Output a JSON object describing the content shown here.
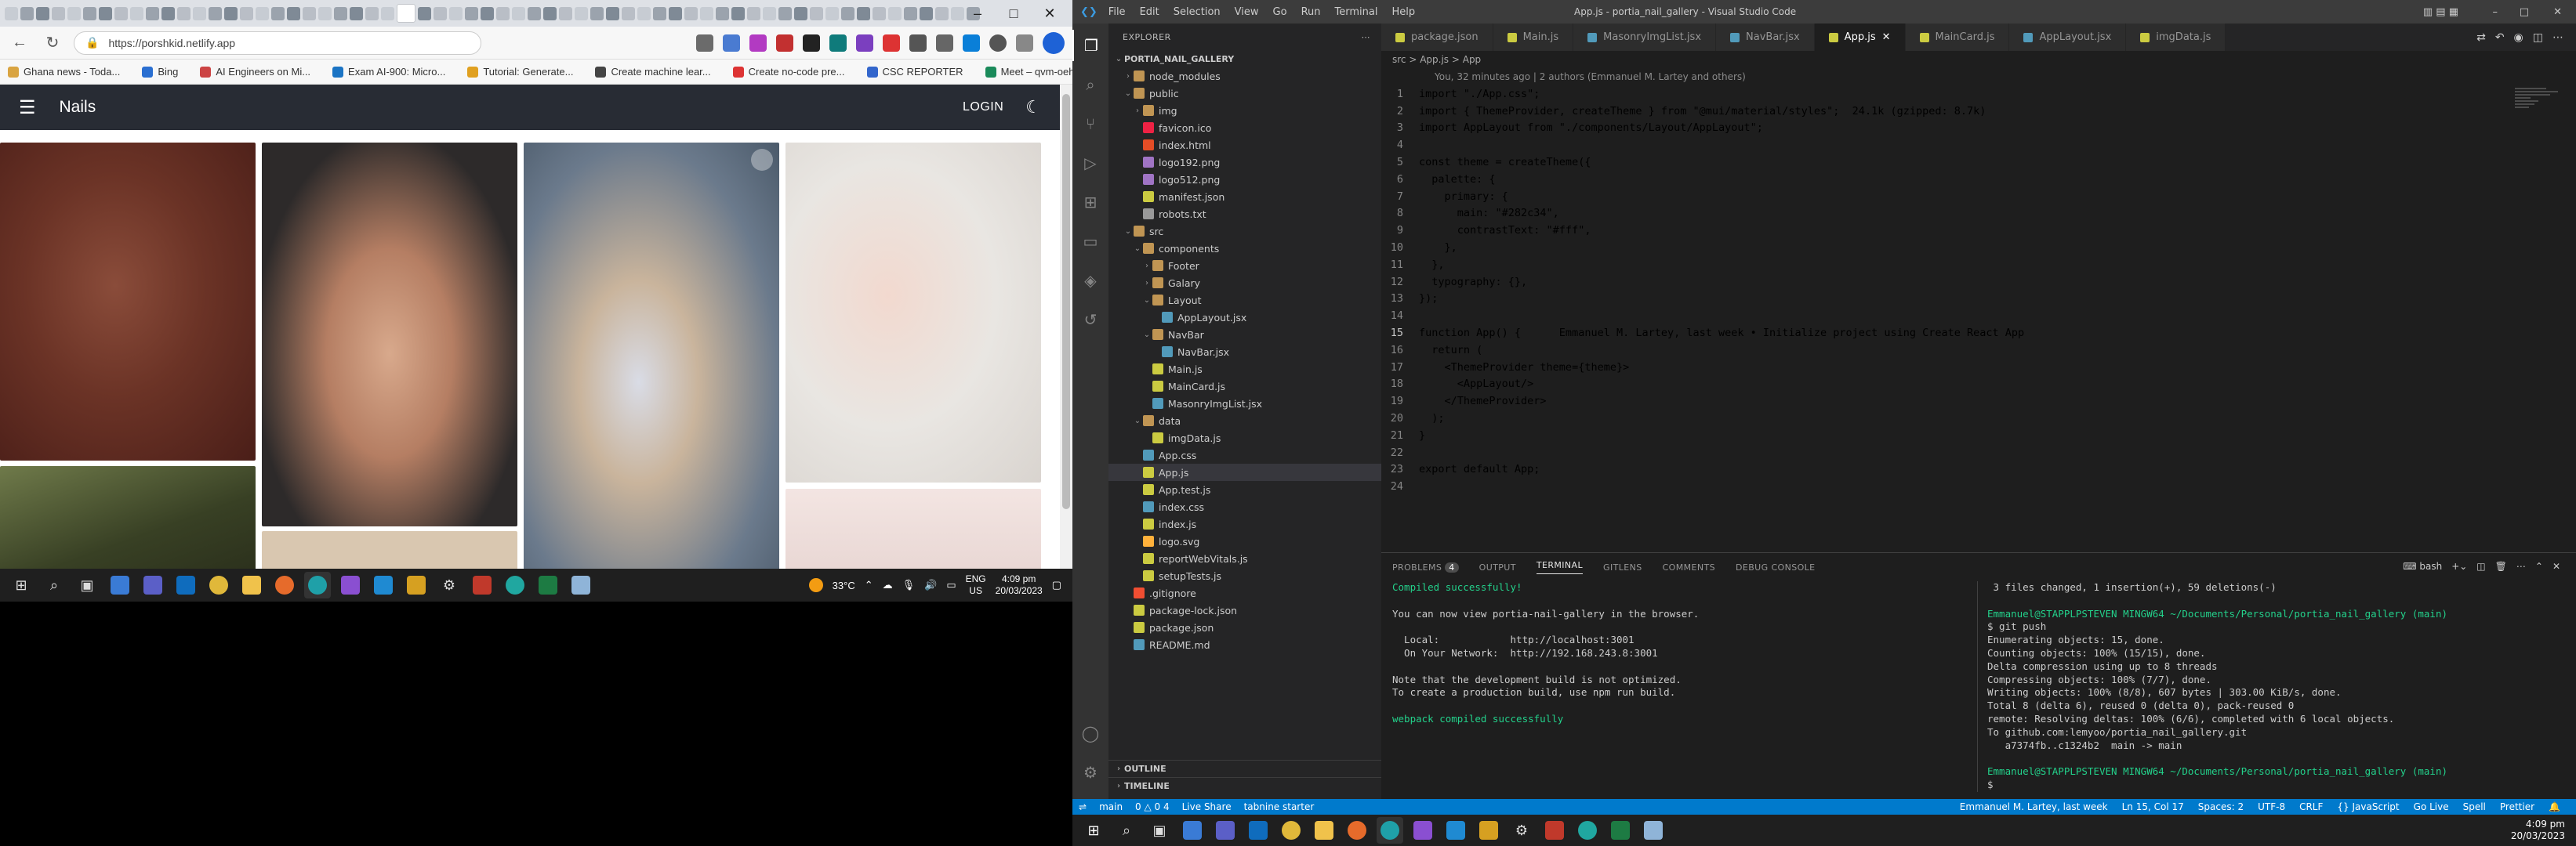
{
  "browser": {
    "url": "https://porshkid.netlify.app",
    "bookmarks": [
      "Ghana news - Toda...",
      "Bing",
      "AI Engineers on Mi...",
      "Exam AI-900: Micro...",
      "Tutorial: Generate...",
      "Create machine lear...",
      "Create no-code pre...",
      "CSC REPORTER",
      "Meet – qvm-oehy-x..."
    ],
    "app": {
      "title": "Nails",
      "login": "LOGIN",
      "header_color": "#282c34"
    }
  },
  "taskbar_left": {
    "weather": "33°C",
    "lang1": "ENG",
    "lang2": "US",
    "time": "4:09 pm",
    "date": "20/03/2023"
  },
  "vscode": {
    "menu": [
      "File",
      "Edit",
      "Selection",
      "View",
      "Go",
      "Run",
      "Terminal",
      "Help"
    ],
    "window_title": "App.js - portia_nail_gallery - Visual Studio Code",
    "explorer_title": "EXPLORER",
    "root": "PORTIA_NAIL_GALLERY",
    "tree": [
      {
        "label": "node_modules",
        "depth": 1,
        "kind": "folder"
      },
      {
        "label": "public",
        "depth": 1,
        "kind": "folder-open"
      },
      {
        "label": "img",
        "depth": 2,
        "kind": "folder"
      },
      {
        "label": "favicon.ico",
        "depth": 2,
        "kind": "ico"
      },
      {
        "label": "index.html",
        "depth": 2,
        "kind": "html"
      },
      {
        "label": "logo192.png",
        "depth": 2,
        "kind": "png"
      },
      {
        "label": "logo512.png",
        "depth": 2,
        "kind": "png"
      },
      {
        "label": "manifest.json",
        "depth": 2,
        "kind": "json"
      },
      {
        "label": "robots.txt",
        "depth": 2,
        "kind": "txt"
      },
      {
        "label": "src",
        "depth": 1,
        "kind": "folder-open"
      },
      {
        "label": "components",
        "depth": 2,
        "kind": "folder-open"
      },
      {
        "label": "Footer",
        "depth": 3,
        "kind": "folder"
      },
      {
        "label": "Galary",
        "depth": 3,
        "kind": "folder"
      },
      {
        "label": "Layout",
        "depth": 3,
        "kind": "folder-open"
      },
      {
        "label": "AppLayout.jsx",
        "depth": 4,
        "kind": "jsx"
      },
      {
        "label": "NavBar",
        "depth": 3,
        "kind": "folder-open"
      },
      {
        "label": "NavBar.jsx",
        "depth": 4,
        "kind": "jsx"
      },
      {
        "label": "Main.js",
        "depth": 3,
        "kind": "js"
      },
      {
        "label": "MainCard.js",
        "depth": 3,
        "kind": "js"
      },
      {
        "label": "MasonryImgList.jsx",
        "depth": 3,
        "kind": "jsx"
      },
      {
        "label": "data",
        "depth": 2,
        "kind": "folder-open"
      },
      {
        "label": "imgData.js",
        "depth": 3,
        "kind": "js"
      },
      {
        "label": "App.css",
        "depth": 2,
        "kind": "css"
      },
      {
        "label": "App.js",
        "depth": 2,
        "kind": "js",
        "selected": true
      },
      {
        "label": "App.test.js",
        "depth": 2,
        "kind": "js"
      },
      {
        "label": "index.css",
        "depth": 2,
        "kind": "css"
      },
      {
        "label": "index.js",
        "depth": 2,
        "kind": "js"
      },
      {
        "label": "logo.svg",
        "depth": 2,
        "kind": "svg"
      },
      {
        "label": "reportWebVitals.js",
        "depth": 2,
        "kind": "js"
      },
      {
        "label": "setupTests.js",
        "depth": 2,
        "kind": "js"
      },
      {
        "label": ".gitignore",
        "depth": 1,
        "kind": "git"
      },
      {
        "label": "package-lock.json",
        "depth": 1,
        "kind": "json"
      },
      {
        "label": "package.json",
        "depth": 1,
        "kind": "json"
      },
      {
        "label": "README.md",
        "depth": 1,
        "kind": "md"
      }
    ],
    "outline": "OUTLINE",
    "timeline": "TIMELINE",
    "tabs": [
      {
        "label": "package.json",
        "kind": "json"
      },
      {
        "label": "Main.js",
        "kind": "js"
      },
      {
        "label": "MasonryImgList.jsx",
        "kind": "jsx"
      },
      {
        "label": "NavBar.jsx",
        "kind": "jsx"
      },
      {
        "label": "App.js",
        "kind": "js",
        "active": true
      },
      {
        "label": "MainCard.js",
        "kind": "js"
      },
      {
        "label": "AppLayout.jsx",
        "kind": "jsx"
      },
      {
        "label": "imgData.js",
        "kind": "js"
      }
    ],
    "breadcrumb": "src  >  App.js  >  App",
    "blame": "You, 32 minutes ago | 2 authors (Emmanuel M. Lartey and others)",
    "code_lines": [
      "import \"./App.css\";",
      "import { ThemeProvider, createTheme } from \"@mui/material/styles\";  24.1k (gzipped: 8.7k)",
      "import AppLayout from \"./components/Layout/AppLayout\";",
      "",
      "const theme = createTheme({",
      "  palette: {",
      "    primary: {",
      "      main: \"#282c34\",",
      "      contrastText: \"#fff\",",
      "    },",
      "  },",
      "  typography: {},",
      "});",
      "",
      "function App() {      Emmanuel M. Lartey, last week • Initialize project using Create React App",
      "  return (",
      "    <ThemeProvider theme={theme}>",
      "      <AppLayout/>",
      "    </ThemeProvider>",
      "  );",
      "}",
      "",
      "export default App;",
      ""
    ],
    "panel_tabs": [
      "PROBLEMS",
      "OUTPUT",
      "TERMINAL",
      "GITLENS",
      "COMMENTS",
      "DEBUG CONSOLE"
    ],
    "problems_count": "4",
    "terminal_left": [
      "Compiled successfully!",
      "",
      "You can now view portia-nail-gallery in the browser.",
      "",
      "  Local:            http://localhost:3001",
      "  On Your Network:  http://192.168.243.8:3001",
      "",
      "Note that the development build is not optimized.",
      "To create a production build, use npm run build.",
      "",
      "webpack compiled successfully"
    ],
    "terminal_shell": "bash",
    "terminal_right": [
      " 3 files changed, 1 insertion(+), 59 deletions(-)",
      "",
      "Emmanuel@STAPPLPSTEVEN MINGW64 ~/Documents/Personal/portia_nail_gallery (main)",
      "$ git push",
      "Enumerating objects: 15, done.",
      "Counting objects: 100% (15/15), done.",
      "Delta compression using up to 8 threads",
      "Compressing objects: 100% (7/7), done.",
      "Writing objects: 100% (8/8), 607 bytes | 303.00 KiB/s, done.",
      "Total 8 (delta 6), reused 0 (delta 0), pack-reused 0",
      "remote: Resolving deltas: 100% (6/6), completed with 6 local objects.",
      "To github.com:lemyoo/portia_nail_gallery.git",
      "   a7374fb..c1324b2  main -> main",
      "",
      "Emmanuel@STAPPLPSTEVEN MINGW64 ~/Documents/Personal/portia_nail_gallery (main)",
      "$ "
    ],
    "status_left": [
      "main",
      "0 △ 0  4",
      "Live Share",
      "tabnine starter"
    ],
    "status_right": [
      "Emmanuel M. Lartey, last week",
      "Ln 15, Col 17",
      "Spaces: 2",
      "UTF-8",
      "CRLF",
      "{} JavaScript",
      "Go Live",
      "Spell",
      "Prettier"
    ],
    "accent": "#007acc"
  },
  "taskbar_right": {
    "time": "4:09 pm",
    "date": "20/03/2023"
  }
}
